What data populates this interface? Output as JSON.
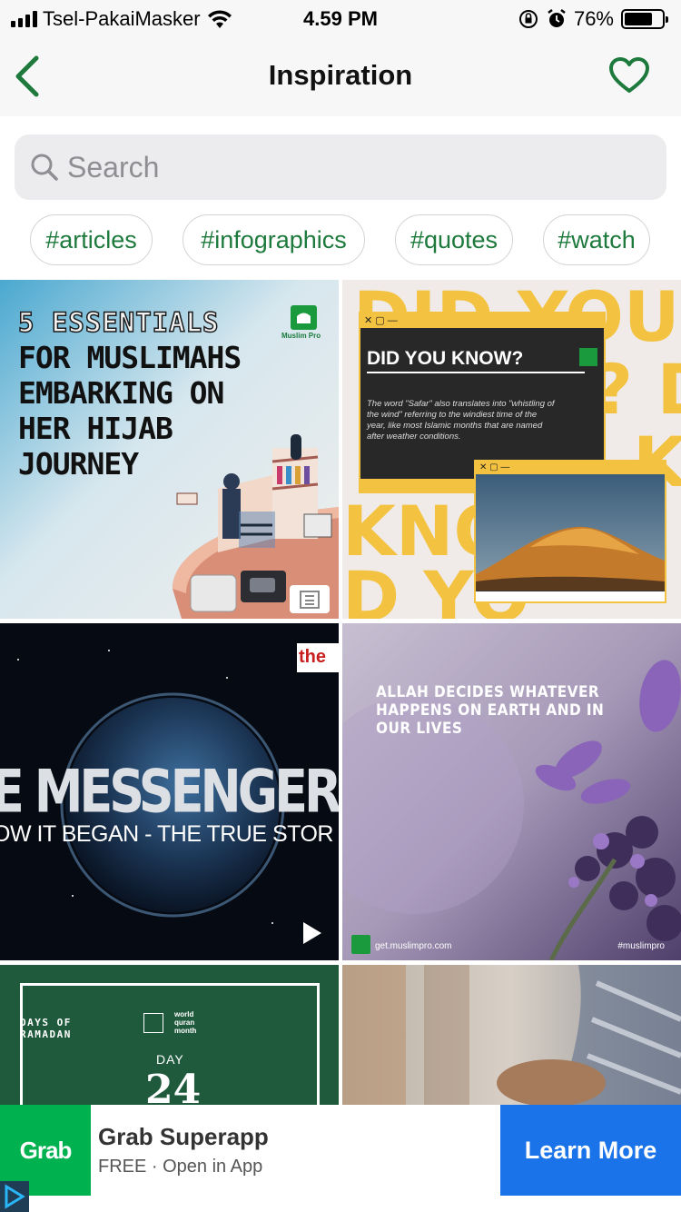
{
  "status_bar": {
    "carrier": "Tsel-PakaiMasker",
    "time": "4.59 PM",
    "battery": "76%",
    "battery_level": 0.76
  },
  "nav": {
    "title": "Inspiration",
    "back_icon": "chevron-left-icon",
    "favorite_icon": "heart-icon"
  },
  "search": {
    "placeholder": "Search",
    "value": ""
  },
  "tags": [
    "#articles",
    "#infographics",
    "#quotes",
    "#watch"
  ],
  "grid": {
    "tile1": {
      "heading": "5 ESSENTIALS",
      "lines": [
        "FOR MUSLIMAHS",
        "EMBARKING ON",
        "HER HIJAB",
        "JOURNEY"
      ],
      "brand": "Muslim Pro",
      "type_icon": "article-icon"
    },
    "tile2": {
      "bg_words": [
        "DID YOU",
        "? D",
        "K",
        "KNO",
        "D YO"
      ],
      "title": "DID YOU KNOW?",
      "body": [
        "The word \"Safar\" also translates into \"whistling of",
        "the wind\" referring to the windiest time of the",
        "year, like most Islamic months that are named",
        "after weather conditions."
      ]
    },
    "tile3": {
      "brand": "the",
      "headline": "E MESSENGER OF GO",
      "subline": "OW IT BEGAN - THE TRUE STOR",
      "type_icon": "play-icon"
    },
    "tile4": {
      "quote": [
        "ALLAH DECIDES WHATEVER",
        "HAPPENS ON EARTH AND IN",
        "OUR LIVES"
      ],
      "url": "get.muslimpro.com",
      "hashtag": "#muslimpro"
    },
    "tile5": {
      "days_label": [
        "DAYS OF",
        "RAMADAN"
      ],
      "partner": [
        "world",
        "quran",
        "month"
      ],
      "day_label": "DAY",
      "day_number": "24"
    }
  },
  "ad": {
    "logo": "Grab",
    "title": "Grab Superapp",
    "subtitle": "FREE · Open in App",
    "cta": "Learn More",
    "colors": {
      "brand": "#00b14f",
      "cta": "#1a73e8"
    }
  },
  "colors": {
    "accent": "#1d7a3c"
  }
}
